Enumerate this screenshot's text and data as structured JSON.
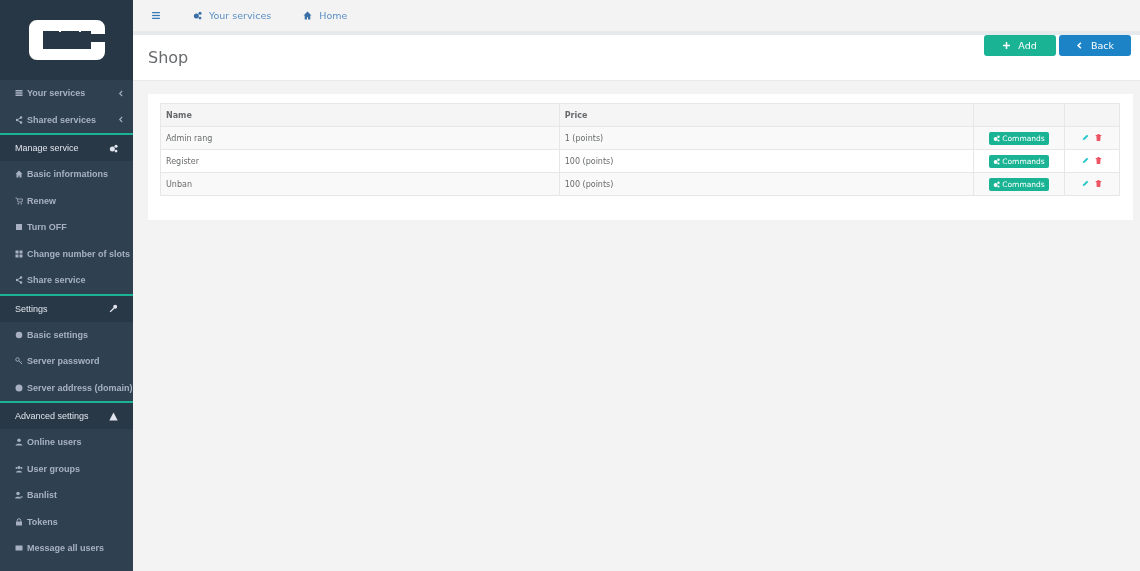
{
  "sidebar": {
    "items": [
      {
        "kind": "group",
        "label": "Your services"
      },
      {
        "kind": "group",
        "label": "Shared services"
      },
      {
        "kind": "header",
        "label": "Manage service"
      },
      {
        "kind": "item",
        "label": "Basic informations"
      },
      {
        "kind": "item",
        "label": "Renew"
      },
      {
        "kind": "item",
        "label": "Turn OFF"
      },
      {
        "kind": "item",
        "label": "Change number of slots"
      },
      {
        "kind": "item",
        "label": "Share service"
      },
      {
        "kind": "header",
        "label": "Settings"
      },
      {
        "kind": "item",
        "label": "Basic settings"
      },
      {
        "kind": "item",
        "label": "Server password"
      },
      {
        "kind": "item",
        "label": "Server address (domain)"
      },
      {
        "kind": "header",
        "label": "Advanced settings"
      },
      {
        "kind": "item",
        "label": "Online users"
      },
      {
        "kind": "item",
        "label": "User groups"
      },
      {
        "kind": "item",
        "label": "Banlist"
      },
      {
        "kind": "item",
        "label": "Tokens"
      },
      {
        "kind": "item",
        "label": "Message all users"
      }
    ]
  },
  "topbar": {
    "links": [
      "Your services",
      "Home"
    ]
  },
  "page": {
    "title": "Shop",
    "buttons": [
      {
        "label": "Add",
        "kind": "add"
      },
      {
        "label": "Back",
        "kind": "back"
      }
    ]
  },
  "table": {
    "columns": [
      "Name",
      "Price"
    ],
    "rows": [
      {
        "name": "Admin rang",
        "price": "1 (points)",
        "action": "Commands"
      },
      {
        "name": "Register",
        "price": "100 (points)",
        "action": "Commands"
      },
      {
        "name": "Unban",
        "price": "100 (points)",
        "action": "Commands"
      }
    ]
  }
}
